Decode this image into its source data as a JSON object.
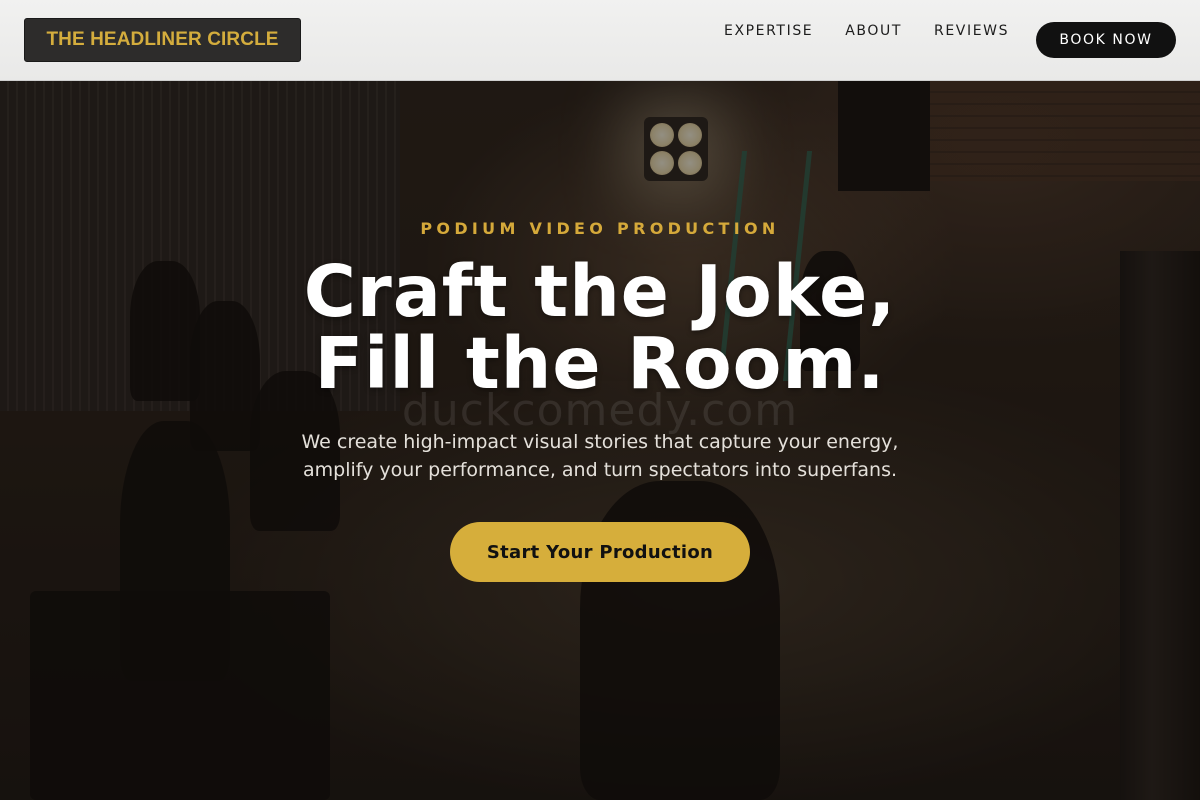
{
  "brand": {
    "logo_text": "THE HEADLINER CIRCLE",
    "accent_color": "#d6ae3b"
  },
  "nav": {
    "items": [
      {
        "label": "EXPERTISE"
      },
      {
        "label": "ABOUT"
      },
      {
        "label": "REVIEWS"
      }
    ],
    "cta_label": "BOOK NOW"
  },
  "hero": {
    "eyebrow": "PODIUM VIDEO PRODUCTION",
    "headline_line1": "Craft the Joke,",
    "headline_line2": "Fill the Room.",
    "watermark": "duckcomedy.com",
    "subtext_line1": "We create high-impact visual stories that capture your energy,",
    "subtext_line2": "amplify your performance, and turn spectators into superfans.",
    "cta_label": "Start Your Production"
  }
}
